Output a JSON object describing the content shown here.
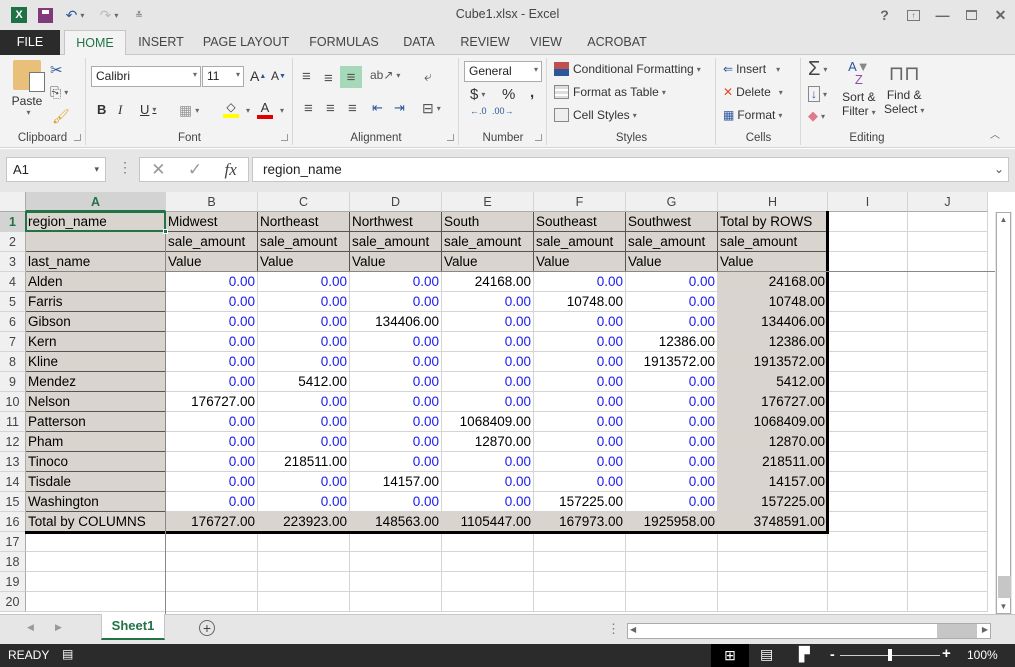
{
  "window": {
    "title": "Cube1.xlsx - Excel",
    "controls": [
      "help-icon",
      "ribbon-display-options-icon",
      "minimize-icon",
      "maximize-icon",
      "close-icon"
    ]
  },
  "quick_access": {
    "icons": [
      "excel-logo-icon",
      "save-icon",
      "undo-icon",
      "redo-icon",
      "customize-qat-icon"
    ]
  },
  "tabs": {
    "file": "FILE",
    "home": "HOME",
    "insert": "INSERT",
    "page_layout": "PAGE LAYOUT",
    "formulas": "FORMULAS",
    "data": "DATA",
    "review": "REVIEW",
    "view": "VIEW",
    "acrobat": "ACROBAT"
  },
  "ribbon": {
    "clipboard": {
      "label": "Clipboard",
      "paste": "Paste"
    },
    "font": {
      "label": "Font",
      "name": "Calibri",
      "size": "11",
      "bold": "B",
      "italic": "I",
      "underline": "U",
      "highlight_color": "#ffff00",
      "font_color": "#e00000"
    },
    "alignment": {
      "label": "Alignment"
    },
    "number": {
      "label": "Number",
      "format": "General",
      "currency": "$",
      "percent": "%",
      "comma": ","
    },
    "styles": {
      "label": "Styles",
      "conditional": "Conditional Formatting",
      "format_table": "Format as Table",
      "cell_styles": "Cell Styles"
    },
    "cells": {
      "label": "Cells",
      "insert": "Insert",
      "delete": "Delete",
      "format": "Format"
    },
    "editing": {
      "label": "Editing",
      "sort1": "Sort &",
      "sort2": "Filter",
      "find1": "Find &",
      "find2": "Select"
    }
  },
  "formula_bar": {
    "name_box": "A1",
    "fx": "fx",
    "content": "region_name"
  },
  "columns": [
    "A",
    "B",
    "C",
    "D",
    "E",
    "F",
    "G",
    "H",
    "I",
    "J"
  ],
  "rows": [
    "1",
    "2",
    "3",
    "4",
    "5",
    "6",
    "7",
    "8",
    "9",
    "10",
    "11",
    "12",
    "13",
    "14",
    "15",
    "16",
    "17",
    "18",
    "19",
    "20"
  ],
  "pivot": {
    "corner": "region_name",
    "row_field": "last_name",
    "regions": [
      "Midwest",
      "Northeast",
      "Northwest",
      "South",
      "Southeast",
      "Southwest",
      "Total by ROWS"
    ],
    "measure": "sale_amount",
    "value_label": "Value",
    "records": [
      {
        "name": "Alden",
        "values": [
          "0.00",
          "0.00",
          "0.00",
          "24168.00",
          "0.00",
          "0.00",
          "24168.00"
        ]
      },
      {
        "name": "Farris",
        "values": [
          "0.00",
          "0.00",
          "0.00",
          "0.00",
          "10748.00",
          "0.00",
          "10748.00"
        ]
      },
      {
        "name": "Gibson",
        "values": [
          "0.00",
          "0.00",
          "134406.00",
          "0.00",
          "0.00",
          "0.00",
          "134406.00"
        ]
      },
      {
        "name": "Kern",
        "values": [
          "0.00",
          "0.00",
          "0.00",
          "0.00",
          "0.00",
          "12386.00",
          "12386.00"
        ]
      },
      {
        "name": "Kline",
        "values": [
          "0.00",
          "0.00",
          "0.00",
          "0.00",
          "0.00",
          "1913572.00",
          "1913572.00"
        ]
      },
      {
        "name": "Mendez",
        "values": [
          "0.00",
          "5412.00",
          "0.00",
          "0.00",
          "0.00",
          "0.00",
          "5412.00"
        ]
      },
      {
        "name": "Nelson",
        "values": [
          "176727.00",
          "0.00",
          "0.00",
          "0.00",
          "0.00",
          "0.00",
          "176727.00"
        ]
      },
      {
        "name": "Patterson",
        "values": [
          "0.00",
          "0.00",
          "0.00",
          "1068409.00",
          "0.00",
          "0.00",
          "1068409.00"
        ]
      },
      {
        "name": "Pham",
        "values": [
          "0.00",
          "0.00",
          "0.00",
          "12870.00",
          "0.00",
          "0.00",
          "12870.00"
        ]
      },
      {
        "name": "Tinoco",
        "values": [
          "0.00",
          "218511.00",
          "0.00",
          "0.00",
          "0.00",
          "0.00",
          "218511.00"
        ]
      },
      {
        "name": "Tisdale",
        "values": [
          "0.00",
          "0.00",
          "14157.00",
          "0.00",
          "0.00",
          "0.00",
          "14157.00"
        ]
      },
      {
        "name": "Washington",
        "values": [
          "0.00",
          "0.00",
          "0.00",
          "0.00",
          "157225.00",
          "0.00",
          "157225.00"
        ]
      }
    ],
    "total_label": "Total by COLUMNS",
    "totals": [
      "176727.00",
      "223923.00",
      "148563.00",
      "1105447.00",
      "167973.00",
      "1925958.00",
      "3748591.00"
    ]
  },
  "sheets": {
    "active": "Sheet1"
  },
  "status": {
    "mode": "READY",
    "zoom": "100%",
    "zoom_level_percent": 100
  }
}
